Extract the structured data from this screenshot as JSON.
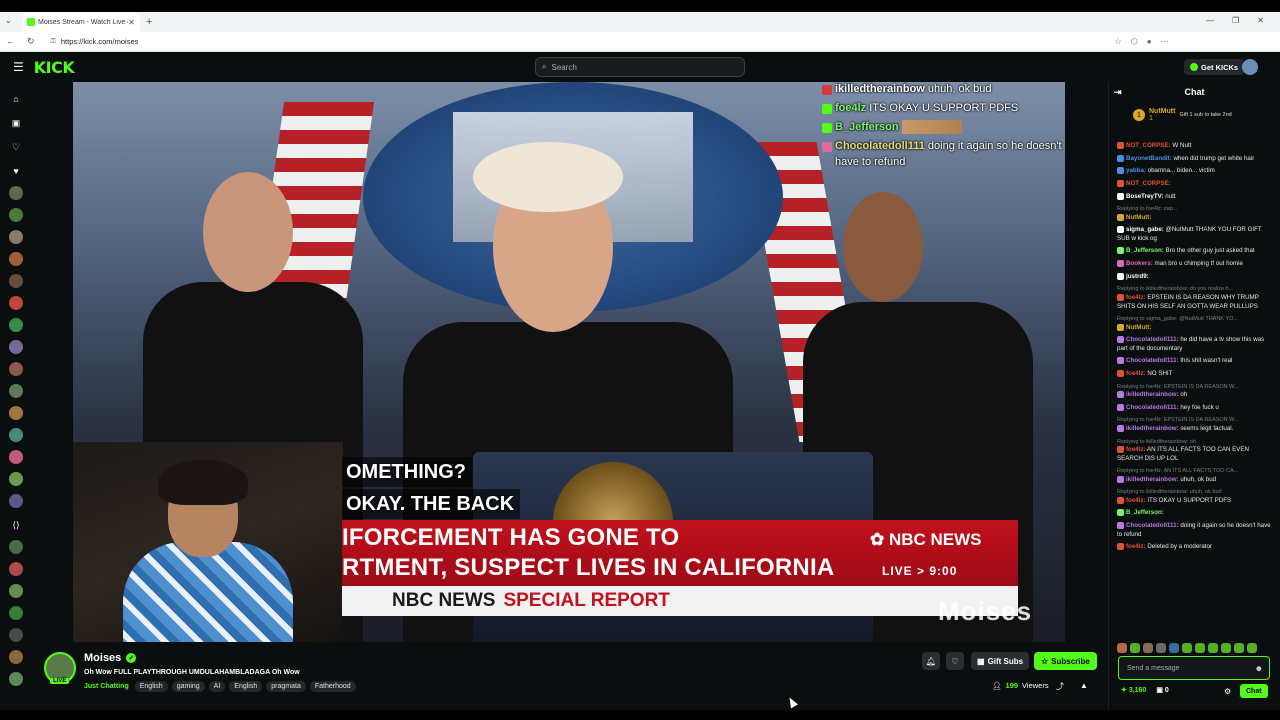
{
  "browser": {
    "tab_title": "Moises Stream - Watch Live o...",
    "url": "https://kick.com/moises"
  },
  "header": {
    "logo": "KICK",
    "search_placeholder": "Search",
    "get_kicks": "Get KICKs"
  },
  "video": {
    "overlay_chat": [
      {
        "user": "ikilledtherainbow",
        "text": " uhuh, ok bud",
        "color": "#ffffff"
      },
      {
        "user": "foe4lz",
        "text": " ITS OKAY U SUPPORT PDFS",
        "color": "#7cf26a"
      },
      {
        "user": "B_Jefferson",
        "text": " ",
        "color": "#7cf26a"
      },
      {
        "user": "Chocolatedoll111",
        "text": " doing it again so he doesn't have to refund",
        "color": "#e8d96a"
      }
    ],
    "caption_lines": [
      "OMETHING?",
      "OKAY. THE BACK"
    ],
    "headline_lines": [
      "IFORCEMENT HAS GONE TO",
      "RTMENT, SUSPECT LIVES IN CALIFORNIA"
    ],
    "nbc_logo": "NBC NEWS",
    "live_time": "LIVE > 9:00",
    "strip_brand": "NBC NEWS",
    "strip_special": "SPECIAL REPORT",
    "watermark": "Moises"
  },
  "stream": {
    "streamer": "Moises",
    "live_label": "LIVE",
    "title": "Oh Wow FULL PLAYTHROUGH UMDULAHAMBLADAGA Oh Wow",
    "category": "Just Chatting",
    "tags": [
      "English",
      "gaming",
      "AI",
      "English",
      "pragmata",
      "Fatherhood"
    ],
    "gift_subs": "Gift Subs",
    "subscribe": "Subscribe",
    "viewers_count": "199",
    "viewers_label": "Viewers"
  },
  "chat": {
    "title": "Chat",
    "pinned": {
      "rank": "1",
      "name": "NutMutt",
      "count": "1",
      "desc": "Gift 1 sub to take 2nd"
    },
    "messages": [
      {
        "reply": "",
        "user": "NOT_CORPSE:",
        "text": " W Nutt",
        "color": "#e0513a"
      },
      {
        "reply": "",
        "user": "BayonetBandit:",
        "text": " when did trump get white hair",
        "color": "#4f8ee0"
      },
      {
        "reply": "",
        "user": "yabba:",
        "text": " obamna... biden... victim",
        "color": "#4f8ee0"
      },
      {
        "reply": "",
        "user": "NOT_CORPSE:",
        "text": " ",
        "color": "#e0513a"
      },
      {
        "reply": "",
        "user": "BoseTreyTV:",
        "text": " nutt",
        "color": "#ffffff"
      },
      {
        "reply": "Replying to foe4lz: cap...",
        "user": "NutMutt:",
        "text": " ",
        "color": "#d9a82a"
      },
      {
        "reply": "",
        "user": "sigma_gabe:",
        "text": " @NutMutt THANK YOU FOR GIFT SUB w kick og",
        "color": "#ffffff"
      },
      {
        "reply": "",
        "user": "B_Jefferson:",
        "text": " Bro the other guy just asked that",
        "color": "#7cf26a"
      },
      {
        "reply": "",
        "user": "Bookers:",
        "text": " man bro u chimping tf out homie",
        "color": "#e06ab6"
      },
      {
        "reply": "",
        "user": "justrd9:",
        "text": " ",
        "color": "#ffffff"
      },
      {
        "reply": "Replying to ikilledtherainbow: do you realize h...",
        "user": "foe4lz:",
        "text": " EPSTEIN IS DA REASON WHY TRUMP SHITS ON HIS SELF AN GOTTA WEAR PULLUPS",
        "color": "#e0513a"
      },
      {
        "reply": "Replying to sigma_gabe: @NutMutt THANK YO...",
        "user": "NutMutt:",
        "text": " ",
        "color": "#d9a82a"
      },
      {
        "reply": "",
        "user": "Chocolatedoll111:",
        "text": " he did have a tv show this was part of the documentary",
        "color": "#b87ae0"
      },
      {
        "reply": "",
        "user": "Chocolatedoll111:",
        "text": " this shit wasn't real",
        "color": "#b87ae0"
      },
      {
        "reply": "",
        "user": "foe4lz:",
        "text": " NO SHIT",
        "color": "#e0513a"
      },
      {
        "reply": "Replying to foe4lz: EPSTEIN IS DA REASON W...",
        "user": "ikilledtherainbow:",
        "text": " oh",
        "color": "#b87ae0"
      },
      {
        "reply": "",
        "user": "Chocolatedoll111:",
        "text": " hey foe fuck u",
        "color": "#b87ae0"
      },
      {
        "reply": "Replying to foe4lz: EPSTEIN IS DA REASON W...",
        "user": "ikilledtherainbow:",
        "text": " seems legit factual.",
        "color": "#b87ae0"
      },
      {
        "reply": "Replying to ikilledtherainbow: oh",
        "user": "foe4lz:",
        "text": " AN ITS ALL FACTS TOO CAN EVEN SEARCH DIS UP LOL",
        "color": "#e0513a"
      },
      {
        "reply": "Replying to foe4lz: AN ITS ALL FACTS TOO CA...",
        "user": "ikilledtherainbow:",
        "text": " uhuh, ok bud",
        "color": "#b87ae0"
      },
      {
        "reply": "Replying to ikilledtherainbow: uhuh, ok bud",
        "user": "foe4lz:",
        "text": " ITS OKAY U SUPPORT PDFS",
        "color": "#e0513a"
      },
      {
        "reply": "",
        "user": "B_Jefferson:",
        "text": " ",
        "color": "#7cf26a"
      },
      {
        "reply": "",
        "user": "Chocolatedoll111:",
        "text": " doing it again so he doesn't have to refund",
        "color": "#b87ae0"
      },
      {
        "reply": "",
        "user": "foe4lz:",
        "text": " Deleted by a moderator",
        "color": "#e0513a"
      }
    ],
    "input_placeholder": "Send a message",
    "points": "3,160",
    "zero": "0",
    "chat_button": "Chat"
  },
  "colors": {
    "accent": "#53fc18",
    "nbc_red": "#c2111d"
  }
}
